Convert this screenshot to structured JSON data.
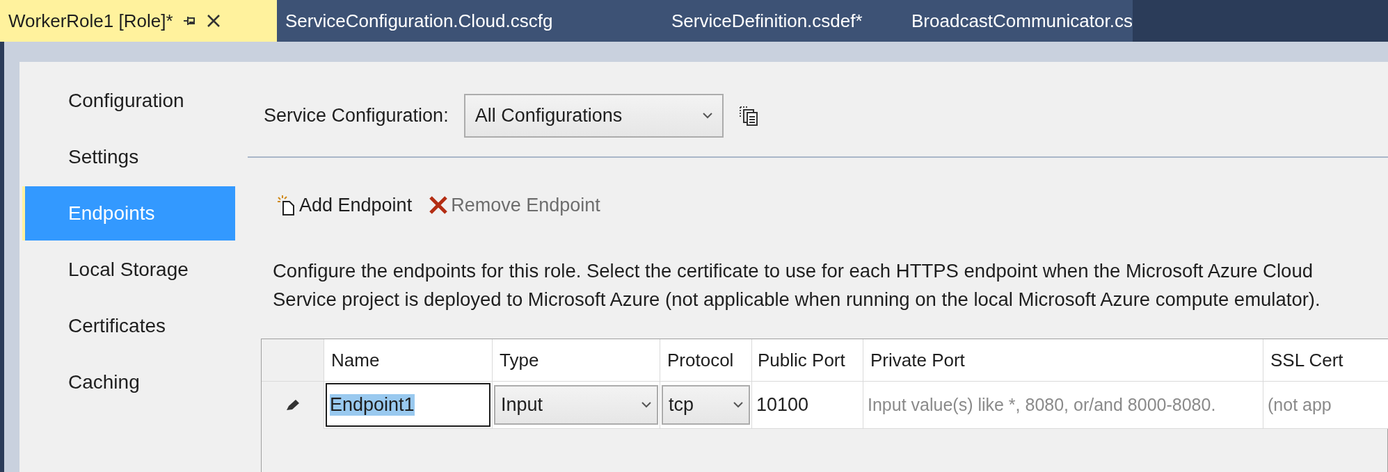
{
  "tabs": [
    {
      "label": "WorkerRole1 [Role]*",
      "selected": true
    },
    {
      "label": "ServiceConfiguration.Cloud.cscfg",
      "selected": false
    },
    {
      "label": "ServiceDefinition.csdef*",
      "selected": false
    },
    {
      "label": "BroadcastCommunicator.cs",
      "selected": false
    }
  ],
  "sidebar": {
    "items": [
      {
        "label": "Configuration",
        "selected": false
      },
      {
        "label": "Settings",
        "selected": false
      },
      {
        "label": "Endpoints",
        "selected": true
      },
      {
        "label": "Local Storage",
        "selected": false
      },
      {
        "label": "Certificates",
        "selected": false
      },
      {
        "label": "Caching",
        "selected": false
      }
    ]
  },
  "service_configuration": {
    "label": "Service Configuration:",
    "value": "All Configurations"
  },
  "toolbar": [
    {
      "label": "Add Endpoint",
      "kind": "add",
      "disabled": false
    },
    {
      "label": "Remove Endpoint",
      "kind": "remove",
      "disabled": true
    }
  ],
  "description": "Configure the endpoints for this role.  Select the certificate to use for each HTTPS endpoint when the Microsoft Azure Cloud Service project is deployed to Microsoft Azure (not applicable when running on the local Microsoft Azure compute emulator).",
  "table": {
    "columns": [
      "Name",
      "Type",
      "Protocol",
      "Public Port",
      "Private Port",
      "SSL Cert"
    ],
    "rows": [
      {
        "editing": true,
        "cells": [
          {
            "kind": "text",
            "value": "Endpoint1",
            "selected": true
          },
          {
            "kind": "dropdown",
            "value": "Input"
          },
          {
            "kind": "dropdown",
            "value": "tcp"
          },
          {
            "kind": "text",
            "value": "10100",
            "selected": false
          },
          {
            "kind": "placeholder",
            "placeholder": "Input value(s) like *, 8080, or/and 8000-8080."
          },
          {
            "kind": "placeholder",
            "placeholder": "(not app"
          }
        ]
      }
    ]
  }
}
